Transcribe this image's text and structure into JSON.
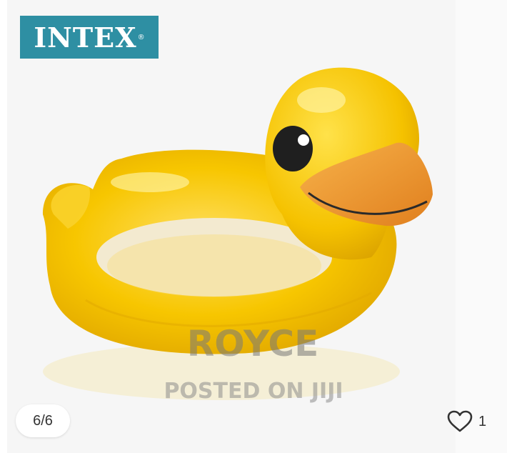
{
  "gallery": {
    "brand_logo_text": "INTEX",
    "brand_logo_mark": "®",
    "watermark_name": "ROYCE",
    "watermark_sub": "POSTED ON JIJI",
    "image_counter": "6/6",
    "like_count": "1",
    "icons": {
      "like": "heart-outline-icon"
    },
    "colors": {
      "logo_bg": "#2e8fa3",
      "duck_yellow": "#f7c600",
      "duck_beak": "#f0a037"
    }
  }
}
